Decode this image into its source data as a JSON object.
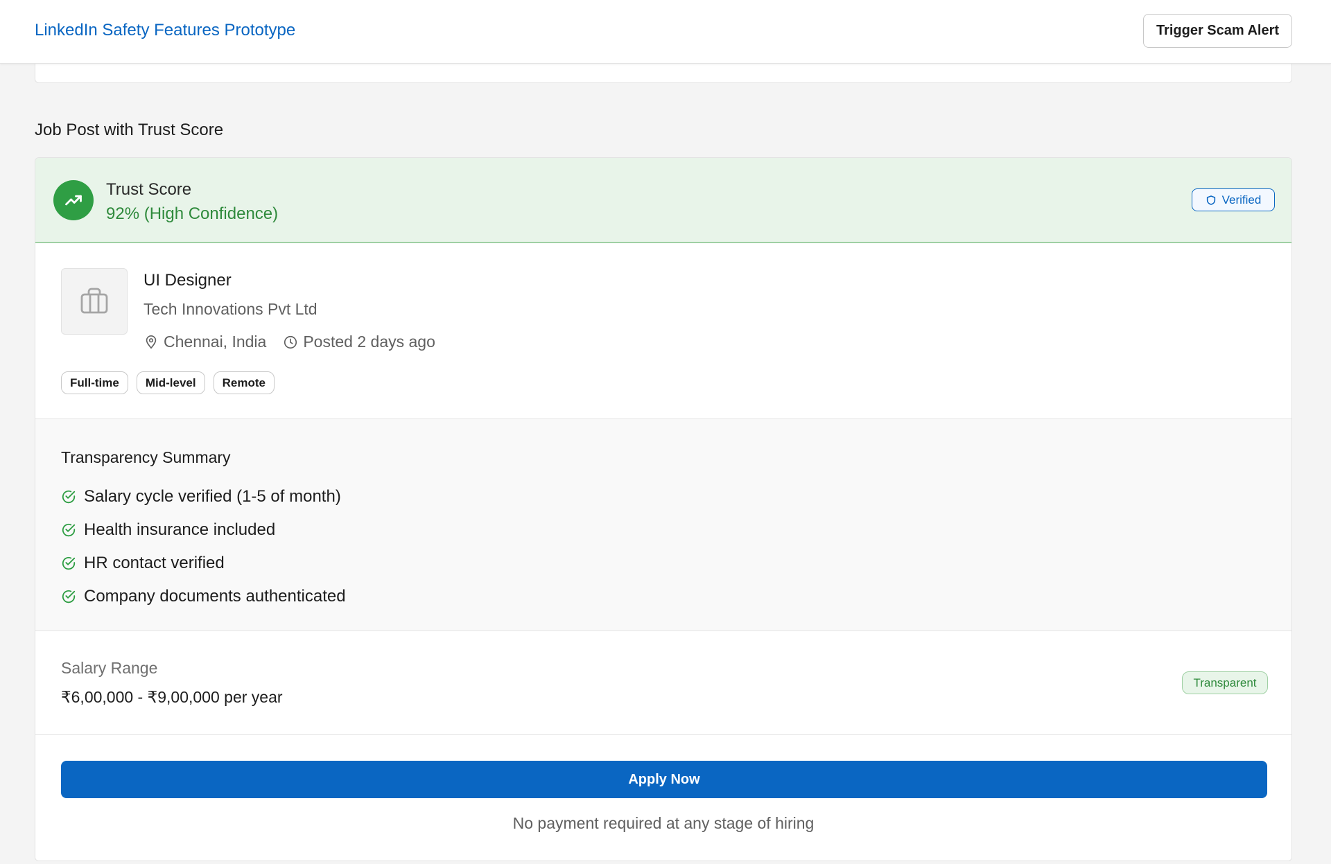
{
  "header": {
    "app_title": "LinkedIn Safety Features Prototype",
    "scam_alert_button": "Trigger Scam Alert"
  },
  "section_title": "Job Post with Trust Score",
  "trust": {
    "label": "Trust Score",
    "value": "92% (High Confidence)",
    "badge": "Verified",
    "icon": "trending-up-icon",
    "score_percent": 92
  },
  "job": {
    "title": "UI Designer",
    "company": "Tech Innovations Pvt Ltd",
    "location": "Chennai, India",
    "posted": "Posted 2 days ago",
    "tags": [
      "Full-time",
      "Mid-level",
      "Remote"
    ]
  },
  "transparency": {
    "title": "Transparency Summary",
    "items": [
      "Salary cycle verified (1-5 of month)",
      "Health insurance included",
      "HR contact verified",
      "Company documents authenticated"
    ]
  },
  "salary": {
    "label": "Salary Range",
    "value": "₹6,00,000 - ₹9,00,000 per year",
    "badge": "Transparent"
  },
  "apply": {
    "button": "Apply Now",
    "note": "No payment required at any stage of hiring"
  },
  "colors": {
    "brand_blue": "#0a66c2",
    "trust_green": "#2f9e44",
    "trust_band_bg": "#e8f4e9"
  }
}
